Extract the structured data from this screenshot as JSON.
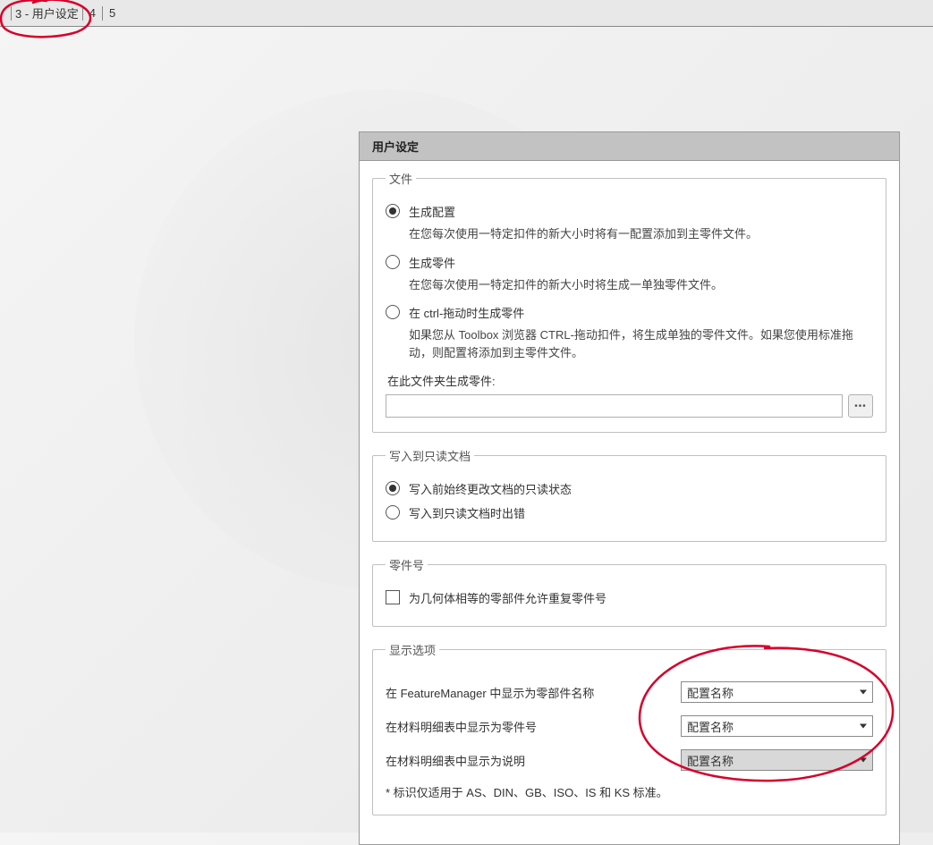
{
  "topbar": {
    "item_current": "3 - 用户设定",
    "item4": "4",
    "item5": "5"
  },
  "dialog": {
    "title": "用户设定",
    "groups": {
      "files": {
        "legend": "文件",
        "opt1_label": "生成配置",
        "opt1_desc": "在您每次使用一特定扣件的新大小时将有一配置添加到主零件文件。",
        "opt2_label": "生成零件",
        "opt2_desc": "在您每次使用一特定扣件的新大小时将生成一单独零件文件。",
        "opt3_label": "在 ctrl-拖动时生成零件",
        "opt3_desc": "如果您从 Toolbox 浏览器 CTRL-拖动扣件，将生成单独的零件文件。如果您使用标准拖动，则配置将添加到主零件文件。",
        "path_label": "在此文件夹生成零件:",
        "path_value": "",
        "browse_icon": "ellipsis"
      },
      "readonly": {
        "legend": "写入到只读文档",
        "opt1_label": "写入前始终更改文档的只读状态",
        "opt2_label": "写入到只读文档时出错"
      },
      "partno": {
        "legend": "零件号",
        "chk_label": "为几何体相等的零部件允许重复零件号"
      },
      "display": {
        "legend": "显示选项",
        "row1_label": "在 FeatureManager 中显示为零部件名称",
        "row1_value": "配置名称",
        "row2_label": "在材料明细表中显示为零件号",
        "row2_value": "配置名称",
        "row3_label": "在材料明细表中显示为说明",
        "row3_value": "配置名称",
        "note": "* 标识仅适用于 AS、DIN、GB、ISO、IS 和 KS 标准。"
      }
    }
  }
}
